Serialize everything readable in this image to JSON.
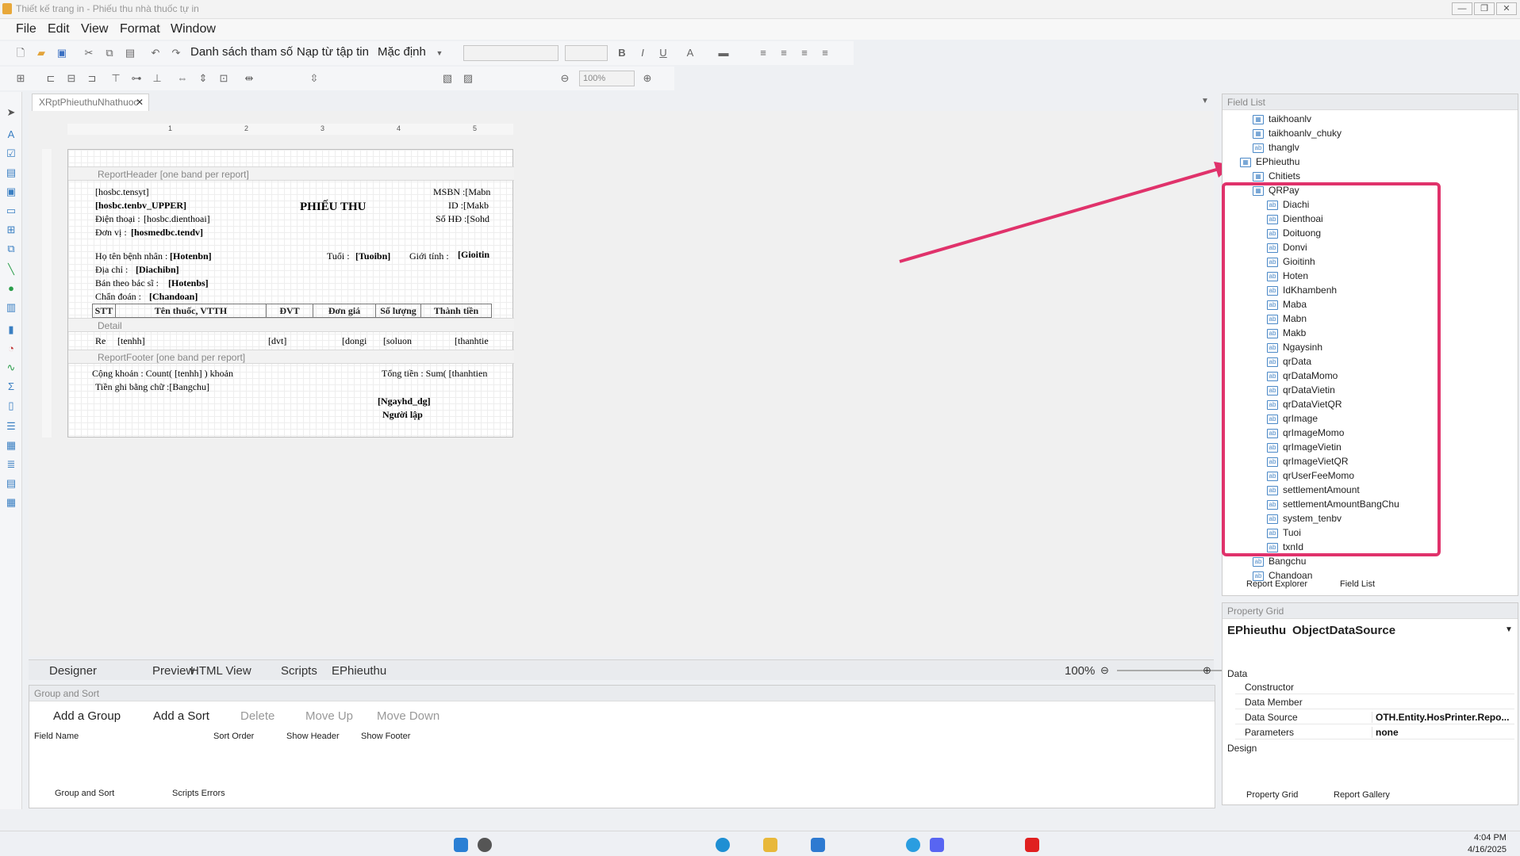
{
  "window": {
    "title": "Thiết kế trang in - Phiếu thu nhà thuốc tự in",
    "min": "—",
    "max": "❐",
    "close": "✕"
  },
  "menu": [
    "File",
    "Edit",
    "View",
    "Format",
    "Window"
  ],
  "toolbar": {
    "btn_params": "Danh sách tham số",
    "btn_load": "Nạp từ tập tin",
    "btn_default": "Mặc định",
    "zoom_combo": "100%"
  },
  "doc_tab": {
    "label": "XRptPhieuthuNhathuoc",
    "close": "✕"
  },
  "ruler": [
    "1",
    "2",
    "3",
    "4",
    "5"
  ],
  "report": {
    "bands": {
      "header": "ReportHeader [one band per report]",
      "detail": "Detail",
      "footer": "ReportFooter [one band per report]"
    },
    "header_fields": [
      "[hosbc.tensyt]",
      "[hosbc.tenbv_UPPER]",
      "Điện thoại :",
      "[hosbc.dienthoai]",
      "Đơn vị :",
      "[hosmedbc.tendv]"
    ],
    "title": "PHIẾU THU",
    "right_fields": [
      "MSBN :[Mabn",
      "ID :[Makb",
      "Số HĐ :[Sohd"
    ],
    "patient": {
      "name_label": "Họ tên bệnh nhân :",
      "name": "[Hotenbn]",
      "age_label": "Tuổi :",
      "age": "[Tuoibn]",
      "sex_label": "Giới tính :",
      "sex": "[Gioitin",
      "addr_label": "Địa chỉ :",
      "addr": "[Diachibn]",
      "doctor_label": "Bán theo bác sĩ :",
      "doctor": "[Hotenbs]",
      "diag_label": "Chẩn đoán :",
      "diag": "[Chandoan]"
    },
    "table_headers": [
      "STT",
      "Tên thuốc, VTTH",
      "ĐVT",
      "Đơn giá",
      "Số lượng",
      "Thành tiền"
    ],
    "detail": [
      "Re",
      "[tenhh]",
      "[dvt]",
      "[dongi",
      "[soluon",
      "[thanhtie"
    ],
    "footer": {
      "count": "Cộng khoản : Count( [tenhh] ) khoản",
      "sum": "Tổng tiền : Sum( [thanhtien",
      "words": "Tiền ghi bằng chữ :[Bangchu]",
      "date": "[Ngayhd_dg]",
      "signer": "Người lập"
    }
  },
  "design_tabs": [
    "Designer",
    "Preview",
    "HTML View",
    "Scripts",
    "EPhieuthu"
  ],
  "zoom": "100%",
  "group_sort": {
    "title": "Group and Sort",
    "add_group": "Add a Group",
    "add_sort": "Add a Sort",
    "delete": "Delete",
    "move_up": "Move Up",
    "move_down": "Move Down",
    "cols": [
      "Field Name",
      "Sort Order",
      "Show Header",
      "Show Footer"
    ],
    "tab1": "Group and Sort",
    "tab2": "Scripts Errors"
  },
  "field_list": {
    "title": "Field List",
    "top_items": [
      "taikhoanlv",
      "taikhoanlv_chuky",
      "thanglv"
    ],
    "root": "EPhieuthu",
    "chitiets": "Chitiets",
    "qrpay": "QRPay",
    "qr_fields": [
      "Diachi",
      "Dienthoai",
      "Doituong",
      "Donvi",
      "Gioitinh",
      "Hoten",
      "IdKhambenh",
      "Maba",
      "Mabn",
      "Makb",
      "Ngaysinh",
      "qrData",
      "qrDataMomo",
      "qrDataVietin",
      "qrDataVietQR",
      "qrImage",
      "qrImageMomo",
      "qrImageVietin",
      "qrImageVietQR",
      "qrUserFeeMomo",
      "settlementAmount",
      "settlementAmountBangChu",
      "system_tenbv",
      "Tuoi",
      "txnId"
    ],
    "after": [
      "Bangchu",
      "Chandoan"
    ],
    "tab1": "Report Explorer",
    "tab2": "Field List"
  },
  "property_grid": {
    "title": "Property Grid",
    "object": "EPhieuthu",
    "type": "ObjectDataSource",
    "cat_data": "Data",
    "cat_design": "Design",
    "rows": [
      {
        "name": "Constructor",
        "value": ""
      },
      {
        "name": "Data Member",
        "value": ""
      },
      {
        "name": "Data Source",
        "value": "OTH.Entity.HosPrinter.Repo..."
      },
      {
        "name": "Parameters",
        "value": "none"
      }
    ],
    "tab1": "Property Grid",
    "tab2": "Report Gallery"
  },
  "clock": {
    "time": "4:04 PM",
    "date": "4/16/2025"
  },
  "colors": {
    "accent": "#e0326b",
    "icon": "#4a88c7"
  }
}
